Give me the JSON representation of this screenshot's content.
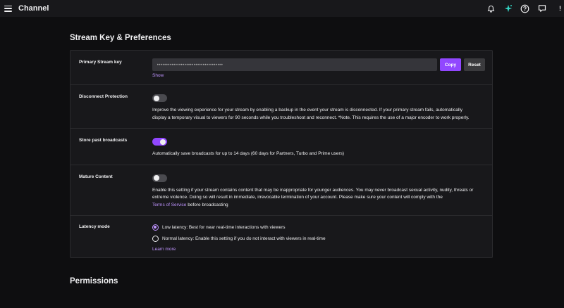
{
  "header": {
    "title": "Channel",
    "icons": [
      "menu-icon",
      "bell-icon",
      "sparkle-icon",
      "help-icon",
      "chat-icon",
      "avatar"
    ],
    "avatar_letter": "!"
  },
  "stream_key_section": {
    "title": "Stream Key & Preferences",
    "primary_key": {
      "label": "Primary Stream key",
      "masked_value": "••••••••••••••••••••••••••••••••••••",
      "copy_label": "Copy",
      "reset_label": "Reset",
      "show_link": "Show"
    },
    "disconnect_protection": {
      "label": "Disconnect Protection",
      "enabled": false,
      "description": "Improve the viewing experience for your stream by enabling a backup in the event your stream is disconnected. If your primary stream fails, automatically display a temporary visual to viewers for 90 seconds while you troubleshoot and reconnect. *Note. This requires the use of a major encoder to work properly."
    },
    "store_broadcasts": {
      "label": "Store past broadcasts",
      "enabled": true,
      "description": "Automatically save broadcasts for up to 14 days (60 days for Partners, Turbo and Prime users)"
    },
    "mature_content": {
      "label": "Mature Content",
      "enabled": false,
      "description_before": "Enable this setting if your stream contains content that may be inappropriate for younger audiences. You may never broadcast sexual activity, nudity, threats or extreme violence. Doing so will result in immediate, irrevocable termination of your account. Please make sure your content will comply with the ",
      "tos_link": "Terms of Service",
      "description_after": " before broadcasting"
    },
    "latency_mode": {
      "label": "Latency mode",
      "options": [
        {
          "text": "Low latency: Best for near real-time interactions with viewers",
          "selected": true
        },
        {
          "text": "Normal latency: Enable this setting if you do not interact with viewers in real-time",
          "selected": false
        }
      ],
      "learn_more": "Learn more"
    }
  },
  "permissions_section": {
    "title": "Permissions"
  },
  "colors": {
    "accent": "#9147ff",
    "link": "#bf94ff",
    "background": "#0e0e10",
    "panel": "#18181b"
  }
}
